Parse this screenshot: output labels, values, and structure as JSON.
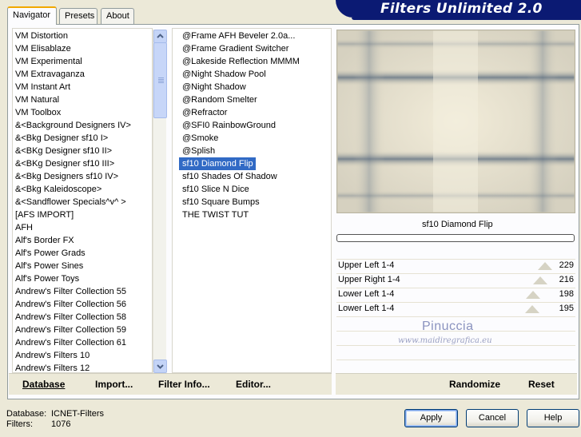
{
  "tabs": [
    {
      "label": "Navigator",
      "active": true
    },
    {
      "label": "Presets",
      "active": false
    },
    {
      "label": "About",
      "active": false
    }
  ],
  "header": {
    "title": "Filters Unlimited 2.0",
    "color": "#0b1a73"
  },
  "categories": [
    "VM Distortion",
    "VM Elisablaze",
    "VM Experimental",
    "VM Extravaganza",
    "VM Instant Art",
    "VM Natural",
    "VM Toolbox",
    "&<Background Designers IV>",
    "&<Bkg Designer sf10 I>",
    "&<BKg Designer sf10 II>",
    "&<BKg Designer sf10 III>",
    "&<Bkg Designers sf10 IV>",
    "&<Bkg Kaleidoscope>",
    "&<Sandflower Specials^v^ >",
    "[AFS IMPORT]",
    "AFH",
    "Alf's Border FX",
    "Alf's Power Grads",
    "Alf's Power Sines",
    "Alf's Power Toys",
    "Andrew's Filter Collection 55",
    "Andrew's Filter Collection 56",
    "Andrew's Filter Collection 58",
    "Andrew's Filter Collection 59",
    "Andrew's Filter Collection 61",
    "Andrew's Filters 10",
    "Andrew's Filters 12"
  ],
  "filters": [
    "@Frame AFH Beveler 2.0a...",
    "@Frame Gradient Switcher",
    "@Lakeside Reflection MMMM",
    "@Night Shadow Pool",
    "@Night Shadow",
    "@Random Smelter",
    "@Refractor",
    "@SFI0 RainbowGround",
    "@Smoke",
    "@Splish",
    "sf10 Diamond Flip",
    "sf10 Shades Of Shadow",
    "sf10 Slice N Dice",
    "sf10 Square Bumps",
    "THE TWIST TUT"
  ],
  "selected_filter_index": 10,
  "selected_color": "#316ac5",
  "preview": {
    "filter_name": "sf10 Diamond Flip"
  },
  "sliders": [
    {
      "label": "Upper Left 1-4",
      "value": "229",
      "level": 229
    },
    {
      "label": "Upper Right 1-4",
      "value": "216",
      "level": 216
    },
    {
      "label": "Lower Left 1-4",
      "value": "198",
      "level": 198
    },
    {
      "label": "Lower Left 1-4",
      "value": "195",
      "level": 195
    }
  ],
  "watermark": {
    "name": "Pinuccia",
    "url": "www.maidiregrafica.eu"
  },
  "toolbar": {
    "database_label": "Database",
    "import_label": "Import...",
    "filter_info_label": "Filter Info...",
    "editor_label": "Editor...",
    "randomize_label": "Randomize",
    "reset_label": "Reset"
  },
  "status": {
    "database_key": "Database:",
    "database_value": "ICNET-Filters",
    "filters_key": "Filters:",
    "filters_value": "1076"
  },
  "buttons": {
    "apply": "Apply",
    "cancel": "Cancel",
    "help": "Help"
  }
}
